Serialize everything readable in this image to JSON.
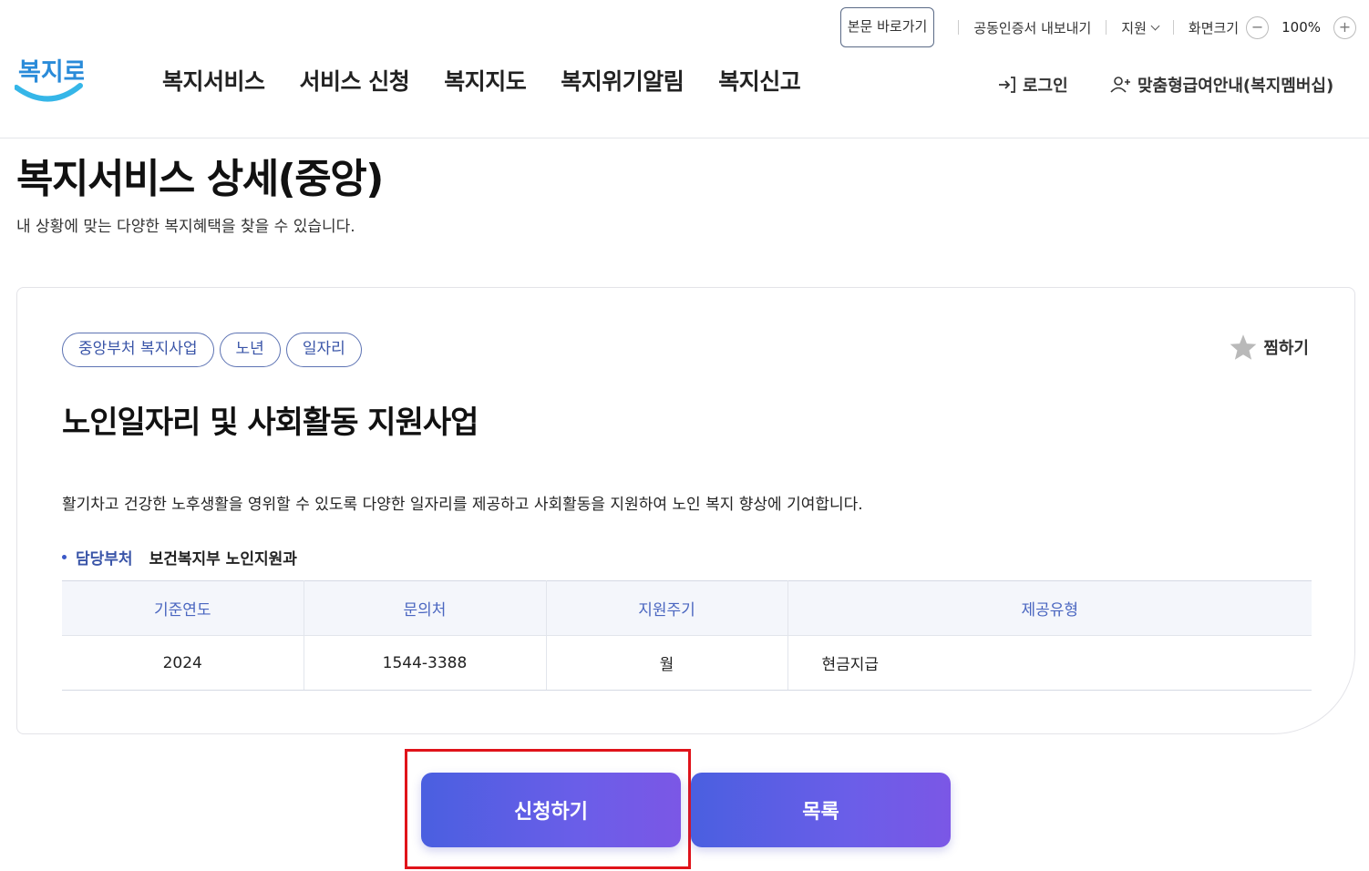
{
  "utility": {
    "skip_to_content": "본문 바로가기",
    "certificate_export": "공동인증서 내보내기",
    "language": "지원",
    "zoom_label": "화면크기",
    "zoom_minus": "−",
    "zoom_value": "100%",
    "zoom_plus": "+"
  },
  "logo": {
    "text": "복지로",
    "colors": {
      "text": "#2a8bd9",
      "swoosh": "#35b6e8"
    }
  },
  "nav": {
    "items": [
      "복지서비스",
      "서비스 신청",
      "복지지도",
      "복지위기알림",
      "복지신고"
    ]
  },
  "account": {
    "login": "로그인",
    "membership": "맞춤형급여안내(복지멤버십)"
  },
  "page": {
    "title": "복지서비스 상세(중앙)",
    "description": "내 상황에 맞는 다양한 복지혜택을 찾을 수 있습니다."
  },
  "service": {
    "tags": [
      "중앙부처 복지사업",
      "노년",
      "일자리"
    ],
    "favorite_label": "찜하기",
    "title": "노인일자리 및 사회활동 지원사업",
    "description": "활기차고 건강한 노후생활을 영위할 수 있도록 다양한 일자리를 제공하고 사회활동을 지원하여 노인 복지 향상에 기여합니다.",
    "department_label": "담당부처",
    "department_value": "보건복지부 노인지원과",
    "table": {
      "headers": [
        "기준연도",
        "문의처",
        "지원주기",
        "제공유형"
      ],
      "row": [
        "2024",
        "1544-3388",
        "월",
        "현금지급"
      ]
    }
  },
  "buttons": {
    "apply": "신청하기",
    "list": "목록"
  },
  "colors": {
    "accent": "#4a66c0",
    "button_gradient_start": "#4a5fe0",
    "button_gradient_end": "#7b57e6",
    "highlight_box": "#e0131a"
  }
}
